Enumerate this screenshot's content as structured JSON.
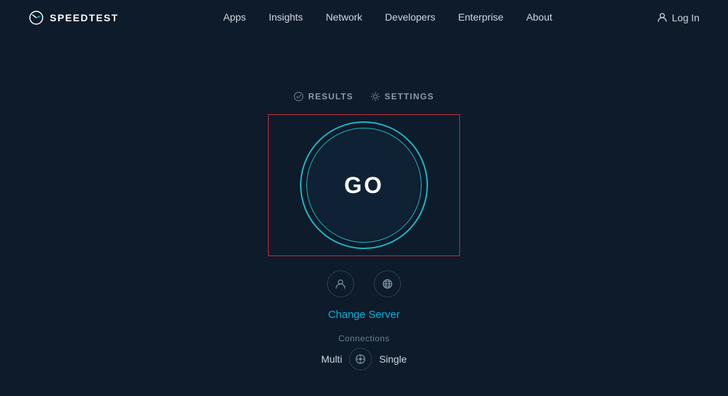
{
  "brand": {
    "name": "SPEEDTEST",
    "logo_alt": "Speedtest logo"
  },
  "nav": {
    "links": [
      {
        "label": "Apps",
        "href": "#"
      },
      {
        "label": "Insights",
        "href": "#"
      },
      {
        "label": "Network",
        "href": "#"
      },
      {
        "label": "Developers",
        "href": "#"
      },
      {
        "label": "Enterprise",
        "href": "#"
      },
      {
        "label": "About",
        "href": "#"
      }
    ],
    "login_label": "Log In"
  },
  "toolbar": {
    "results_label": "RESULTS",
    "settings_label": "SETTINGS"
  },
  "go_button": {
    "label": "GO"
  },
  "change_server": {
    "label": "Change Server"
  },
  "connections": {
    "label": "Connections",
    "multi": "Multi",
    "single": "Single"
  },
  "icons": {
    "results_icon": "⊙",
    "settings_icon": "⚙",
    "user_icon": "👤",
    "globe_icon": "🌐",
    "toggle_icon": "⊙"
  }
}
